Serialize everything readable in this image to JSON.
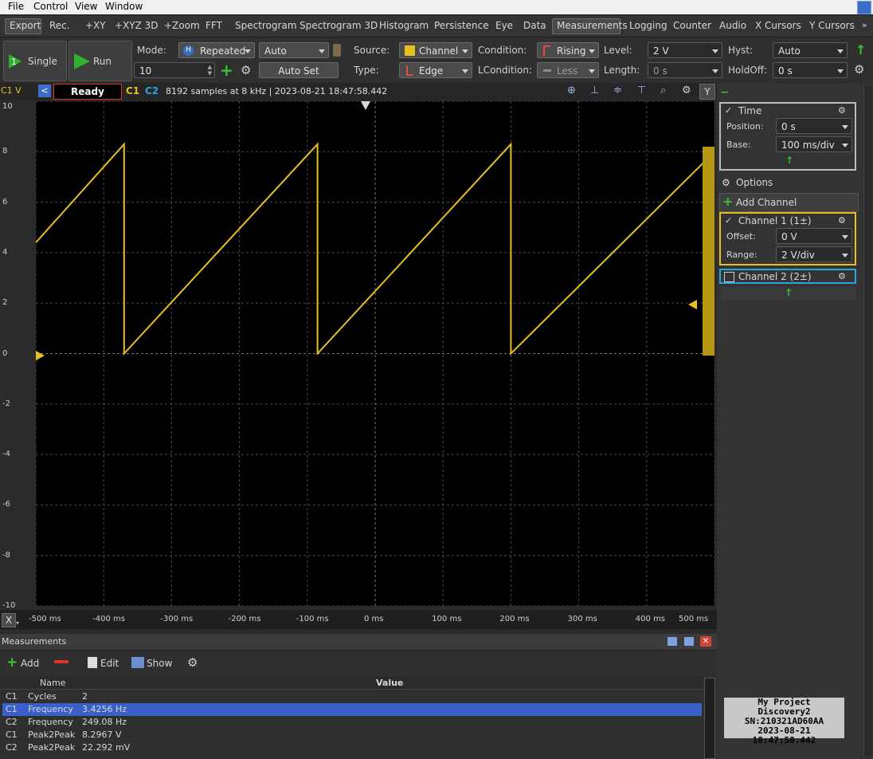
{
  "menu": [
    "File",
    "Control",
    "View",
    "Window"
  ],
  "tabs": [
    "Export",
    "Rec.",
    "+XY",
    "+XYZ 3D",
    "+Zoom",
    "FFT",
    "Spectrogram",
    "Spectrogram 3D",
    "Histogram",
    "Persistence",
    "Eye",
    "Data",
    "Measurements",
    "Logging",
    "Counter",
    "Audio",
    "X Cursors",
    "Y Cursors"
  ],
  "controls": {
    "single": "Single",
    "run": "Run",
    "mode_label": "Mode:",
    "mode_value": "Repeated",
    "mode_auto": "Auto",
    "mode_count": "10",
    "autoset": "Auto Set",
    "source_label": "Source:",
    "source_value": "Channel 1",
    "type_label": "Type:",
    "type_value": "Edge",
    "condition_label": "Condition:",
    "condition_value": "Rising",
    "lcondition_label": "LCondition:",
    "lcondition_value": "Less",
    "level_label": "Level:",
    "level_value": "2 V",
    "length_label": "Length:",
    "length_value": "0 s",
    "hyst_label": "Hyst:",
    "hyst_value": "Auto",
    "holdoff_label": "HoldOff:",
    "holdoff_value": "0 s"
  },
  "plotbar": {
    "axis_label": "C1 V",
    "status": "Ready",
    "c1": "C1",
    "c2": "C2",
    "info": "8192 samples at 8 kHz | 2023-08-21 18:47:58.442",
    "y_button": "Y"
  },
  "axes": {
    "y_ticks": [
      "10",
      "8",
      "6",
      "4",
      "2",
      "0",
      "-2",
      "-4",
      "-6",
      "-8",
      "-10"
    ],
    "x_ticks": [
      "-500 ms",
      "-400 ms",
      "-300 ms",
      "-200 ms",
      "-100 ms",
      "0 ms",
      "100 ms",
      "200 ms",
      "300 ms",
      "400 ms",
      "500 ms"
    ],
    "x_button": "X"
  },
  "chart_data": {
    "type": "line",
    "xlabel": "",
    "ylabel": "C1 V",
    "xlim": [
      -500,
      500
    ],
    "ylim": [
      -10,
      10
    ],
    "grid": true,
    "series": [
      {
        "name": "C1",
        "color": "#e6c01f",
        "x": [
          -500,
          -370,
          -370,
          -85,
          -85,
          200,
          200,
          500
        ],
        "y": [
          4.4,
          8.3,
          0,
          8.3,
          0,
          8.3,
          0,
          8.0
        ]
      }
    ]
  },
  "right": {
    "time_label": "Time",
    "position_label": "Position:",
    "position_value": "0 s",
    "base_label": "Base:",
    "base_value": "100 ms/div",
    "options": "Options",
    "add_channel": "Add Channel",
    "ch1": "Channel 1 (1±)",
    "offset_label": "Offset:",
    "offset_value": "0 V",
    "range_label": "Range:",
    "range_value": "2 V/div",
    "ch2": "Channel 2 (2±)"
  },
  "measurements": {
    "title": "Measurements",
    "add": "Add",
    "edit": "Edit",
    "show": "Show",
    "headers": [
      "Name",
      "Value"
    ],
    "rows": [
      {
        "ch": "C1",
        "name": "Cycles",
        "value": "2"
      },
      {
        "ch": "C1",
        "name": "Frequency",
        "value": "3.4256 Hz"
      },
      {
        "ch": "C2",
        "name": "Frequency",
        "value": "249.08 Hz"
      },
      {
        "ch": "C1",
        "name": "Peak2Peak",
        "value": "8.2967 V"
      },
      {
        "ch": "C2",
        "name": "Peak2Peak",
        "value": "22.292 mV"
      }
    ]
  },
  "device": {
    "line1": "My Project",
    "line2": "Discovery2",
    "line3": "SN:210321AD60AA",
    "line4": "2023-08-21 18:47:58.442"
  },
  "colors": {
    "c1": "#e6c01f",
    "c2": "#25a7d8",
    "selected": "#3a5fc8",
    "status_border": "#e0322a"
  }
}
